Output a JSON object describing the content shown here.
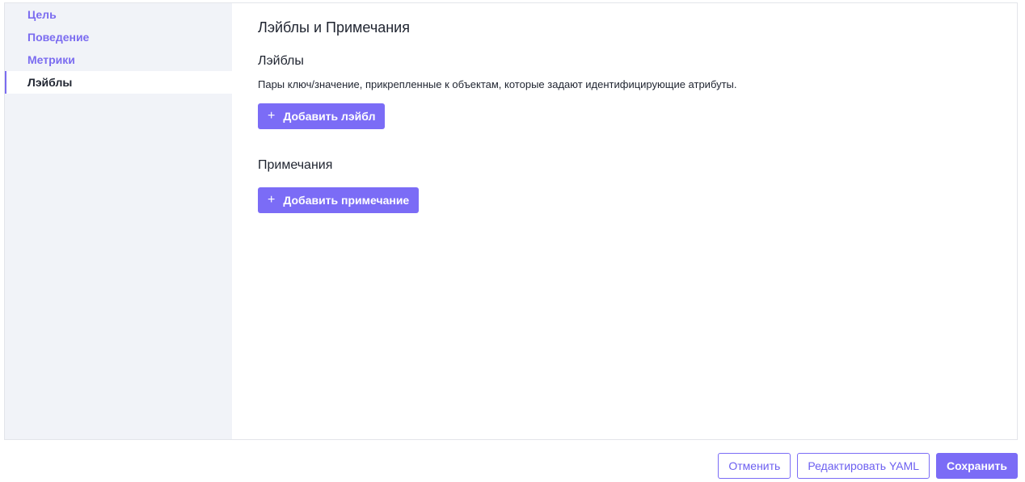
{
  "sidebar": {
    "items": [
      {
        "label": "Цель",
        "active": false
      },
      {
        "label": "Поведение",
        "active": false
      },
      {
        "label": "Метрики",
        "active": false
      },
      {
        "label": "Лэйблы",
        "active": true
      }
    ]
  },
  "main": {
    "title": "Лэйблы и Примечания",
    "labels_section": {
      "title": "Лэйблы",
      "description": "Пары ключ/значение, прикрепленные к объектам, которые задают идентифицирующие атрибуты.",
      "add_button": "Добавить лэйбл",
      "add_icon": "+"
    },
    "annotations_section": {
      "title": "Примечания",
      "add_button": "Добавить примечание",
      "add_icon": "+"
    }
  },
  "footer": {
    "cancel": "Отменить",
    "edit_yaml": "Редактировать YAML",
    "save": "Сохранить"
  },
  "colors": {
    "accent": "#7b6cf6",
    "sidebar_bg": "#f1f3f8"
  }
}
